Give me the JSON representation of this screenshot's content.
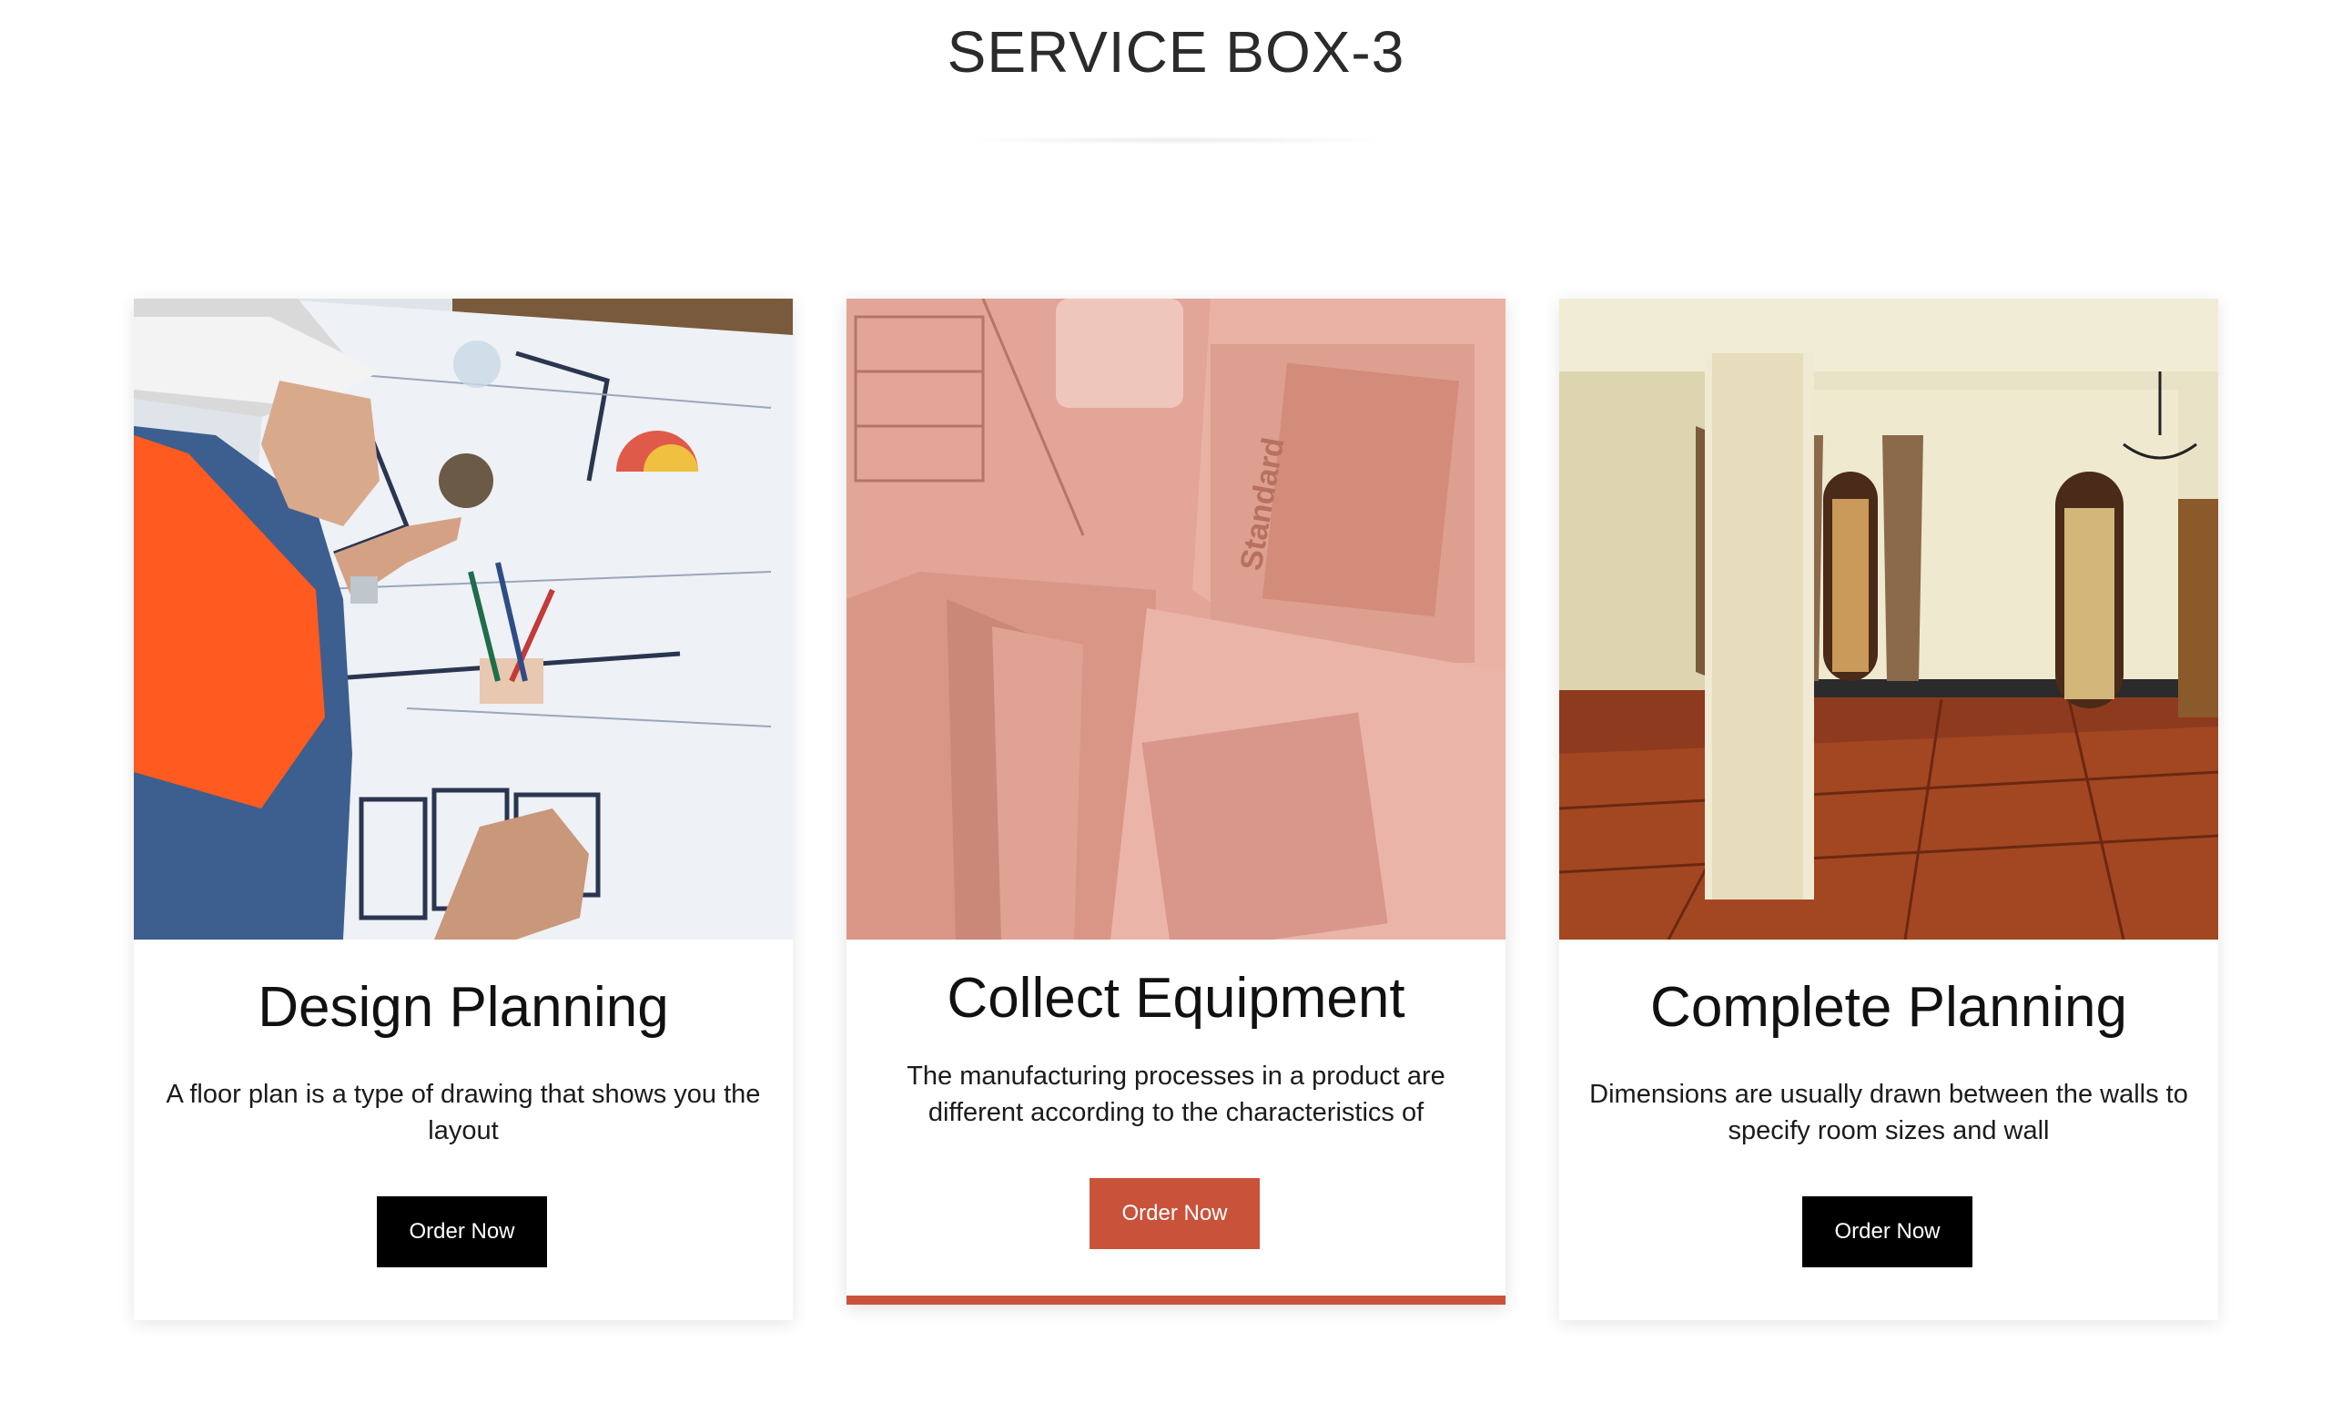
{
  "section": {
    "title": "SERVICE BOX-3"
  },
  "colors": {
    "accent": "#c9523a",
    "button_dark": "#000000",
    "text": "#1a1a1a"
  },
  "cards": [
    {
      "image": "architect-reviewing-blueprint-photo",
      "title": "Design Planning",
      "text": "A floor plan is a type of drawing that shows you the layout",
      "button": "Order Now",
      "active": false
    },
    {
      "image": "material-swatches-on-plans-photo",
      "title": "Collect Equipment",
      "text": "The manufacturing processes in a product are different according to the characteristics of",
      "button": "Order Now",
      "active": true
    },
    {
      "image": "empty-room-with-wood-floor-photo",
      "title": "Complete Planning",
      "text": "Dimensions are usually drawn between the walls to specify room sizes and wall",
      "button": "Order Now",
      "active": false
    }
  ]
}
